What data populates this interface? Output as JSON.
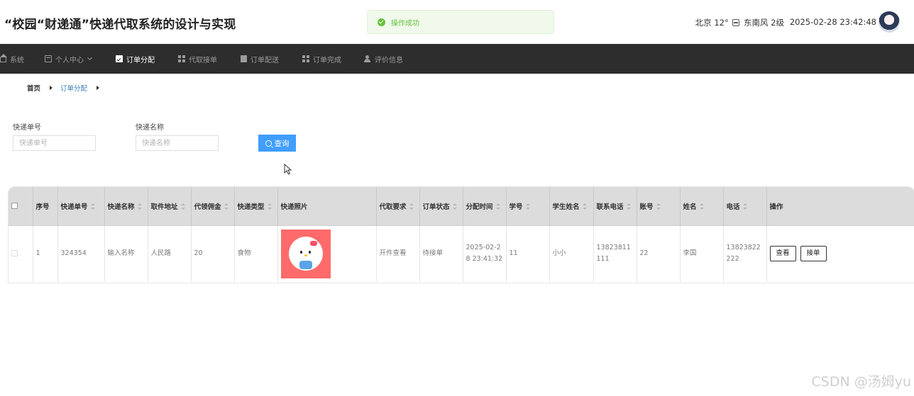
{
  "header": {
    "title": "“校园“财递通”快递代取系统的设计与实现",
    "toast": "操作成功",
    "weather": {
      "city": "北京",
      "temp": "12°",
      "icon": "cloud-icon",
      "wind": "东南风 2级"
    },
    "datetime": "2025-02-28 23:42:48"
  },
  "nav": {
    "items": [
      {
        "label": "系统",
        "icon": "home-icon"
      },
      {
        "label": "个人中心",
        "icon": "card-icon",
        "dropdown": true
      },
      {
        "label": "订单分配",
        "icon": "clipboard-icon",
        "active": true
      },
      {
        "label": "代取接单",
        "icon": "grid-icon"
      },
      {
        "label": "订单配送",
        "icon": "board-icon"
      },
      {
        "label": "订单完成",
        "icon": "grid-icon"
      },
      {
        "label": "评价信息",
        "icon": "user-icon"
      }
    ]
  },
  "breadcrumb": {
    "home": "首页",
    "current": "订单分配"
  },
  "search": {
    "field1": {
      "label": "快递单号",
      "placeholder": "快递单号"
    },
    "field2": {
      "label": "快递名称",
      "placeholder": "快递名称"
    },
    "button": "查询"
  },
  "table": {
    "headers": {
      "index": "序号",
      "trackno": "快递单号",
      "name": "快递名称",
      "address": "取件地址",
      "fee": "代领佣金",
      "type": "快递类型",
      "photo": "快递照片",
      "require": "代取要求",
      "status": "订单状态",
      "time": "分配时间",
      "sid": "学号",
      "sname": "学生姓名",
      "phone": "联系电话",
      "account": "账号",
      "rname": "姓名",
      "rphone": "电话",
      "op": "操作"
    },
    "rows": [
      {
        "index": "1",
        "trackno": "324354",
        "name": "输入名称",
        "address": "人民路",
        "fee": "20",
        "type": "食物",
        "require": "开件查看",
        "status": "待接单",
        "time": "2025-02-28 23:41:32",
        "sid": "11",
        "sname": "小小",
        "phone": "13823811111",
        "account": "22",
        "rname": "李国",
        "rphone": "13823822222",
        "view": "查看",
        "accept": "接单"
      }
    ]
  },
  "watermark": "CSDN @汤姆yu"
}
